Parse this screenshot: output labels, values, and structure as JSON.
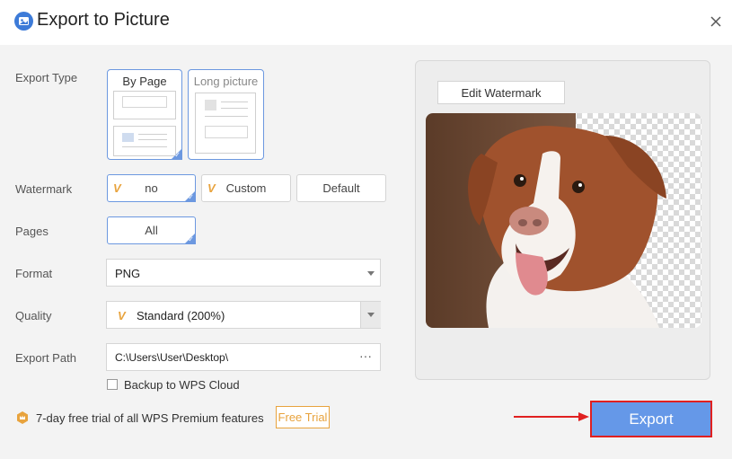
{
  "window": {
    "title": "Export to Picture"
  },
  "labels": {
    "export_type": "Export Type",
    "watermark": "Watermark",
    "pages": "Pages",
    "format": "Format",
    "quality": "Quality",
    "export_path": "Export Path"
  },
  "export_type": {
    "options": [
      "By Page",
      "Long picture"
    ],
    "selected": "By Page"
  },
  "watermark": {
    "options": [
      "no",
      "Custom",
      "Default"
    ],
    "selected": "no"
  },
  "pages": {
    "value": "All"
  },
  "format": {
    "value": "PNG"
  },
  "quality": {
    "value": "Standard (200%)"
  },
  "export_path": {
    "value": "C:\\Users\\User\\Desktop\\",
    "browse_icon": "···"
  },
  "backup": {
    "label": "Backup to WPS Cloud",
    "checked": false
  },
  "preview": {
    "edit_watermark": "Edit Watermark"
  },
  "footer": {
    "trial_text": "7-day free trial of all WPS Premium features",
    "trial_button": "Free Trial"
  },
  "actions": {
    "export": "Export"
  },
  "colors": {
    "accent": "#6c98e0",
    "export_bg": "#6598e8",
    "highlight": "#e02020",
    "premium": "#e8a33d"
  }
}
